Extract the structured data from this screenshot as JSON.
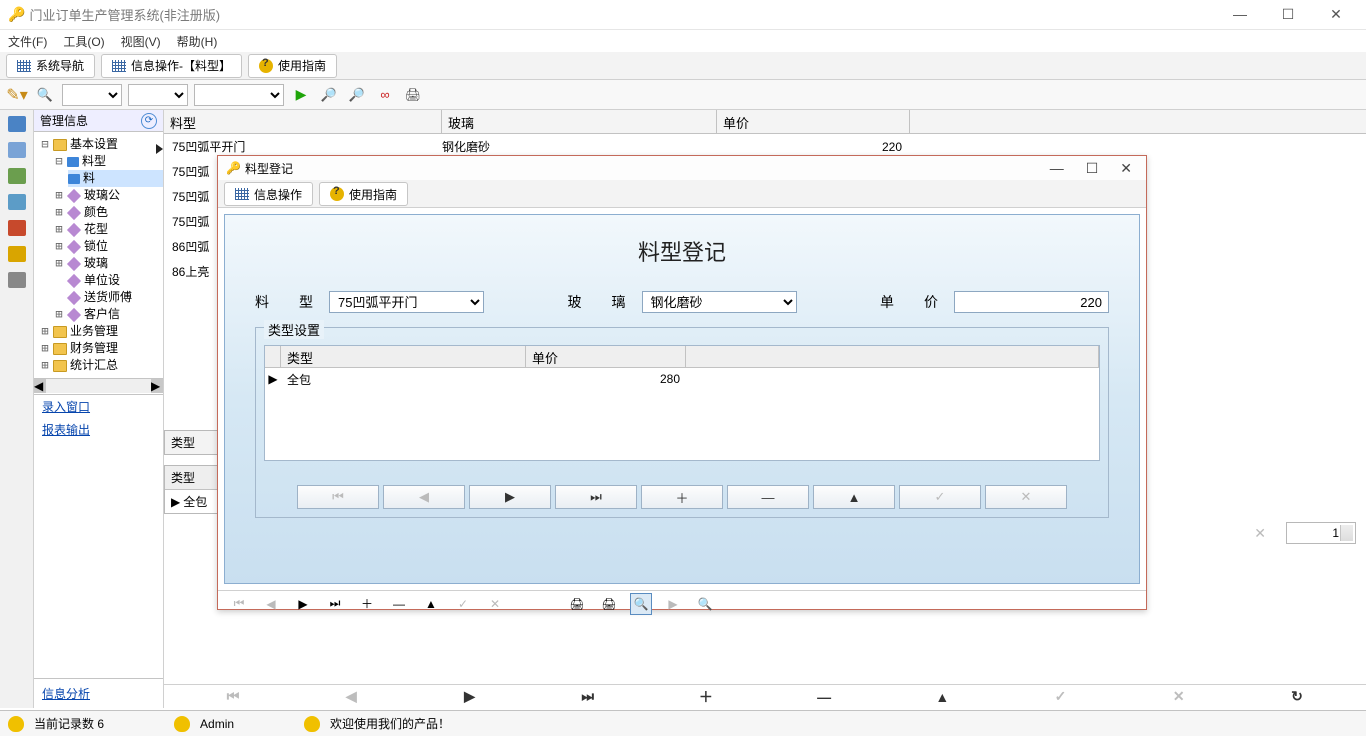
{
  "window": {
    "title": "门业订单生产管理系统(非注册版)"
  },
  "menu": {
    "m1": "文件(F)",
    "m2": "工具(O)",
    "m3": "视图(V)",
    "m4": "帮助(H)"
  },
  "tabs": {
    "t1": "系统导航",
    "t2": "信息操作-【料型】",
    "t3": "使用指南"
  },
  "leftHeader": "管理信息",
  "tree": {
    "root": "基本设置",
    "n1": "料型",
    "n2": "料",
    "n3": "玻璃公",
    "n4": "颜色",
    "n5": "花型",
    "n6": "锁位",
    "n7": "玻璃",
    "n8": "单位设",
    "n9": "送货师傅",
    "n10": "客户信",
    "b1": "业务管理",
    "b2": "财务管理",
    "b3": "统计汇总"
  },
  "leftLinks": {
    "l1": "录入窗口",
    "l2": "报表输出",
    "l3": "信息分析"
  },
  "grid": {
    "h1": "料型",
    "h2": "玻璃",
    "h3": "单价",
    "r1c1": "75凹弧平开门",
    "r1c2": "钢化磨砂",
    "r1c3": "220",
    "r2c1": "75凹弧",
    "r3c1": "75凹弧",
    "r4c1": "75凹弧",
    "r5c1": "86凹弧",
    "r6c1": "86上亮"
  },
  "sub": {
    "label": "类型",
    "head": "类型",
    "row": "全包"
  },
  "pageNum": "1",
  "dialog": {
    "title": "料型登记",
    "tabs": {
      "t1": "信息操作",
      "t2": "使用指南"
    },
    "heading": "料型登记",
    "f1l": "料　型",
    "f1v": "75凹弧平开门",
    "f2l": "玻　璃",
    "f2v": "钢化磨砂",
    "f3l": "单　价",
    "f3v": "220",
    "fieldset": "类型设置",
    "th1": "类型",
    "th2": "单价",
    "tr1a": "全包",
    "tr1b": "280"
  },
  "status": {
    "records": "当前记录数  6",
    "user": "Admin",
    "welcome": "欢迎使用我们的产品！"
  }
}
